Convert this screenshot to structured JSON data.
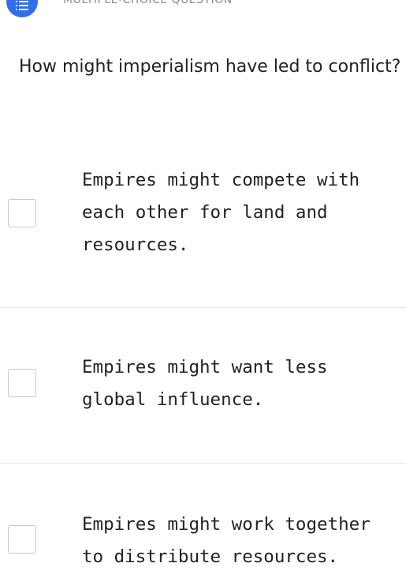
{
  "header": {
    "type_icon": "list-icon",
    "type_label": "MULTIPLE-CHOICE QUESTION",
    "accent_color": "#2f6fe8"
  },
  "question": {
    "text": "How might imperialism have led to conflict?"
  },
  "options": [
    {
      "text": "Empires might compete with\neach other for land and\nresources.",
      "checked": false
    },
    {
      "text": "Empires might want less\nglobal influence.",
      "checked": false
    },
    {
      "text": "Empires might work together\nto distribute resources.",
      "checked": false
    }
  ]
}
